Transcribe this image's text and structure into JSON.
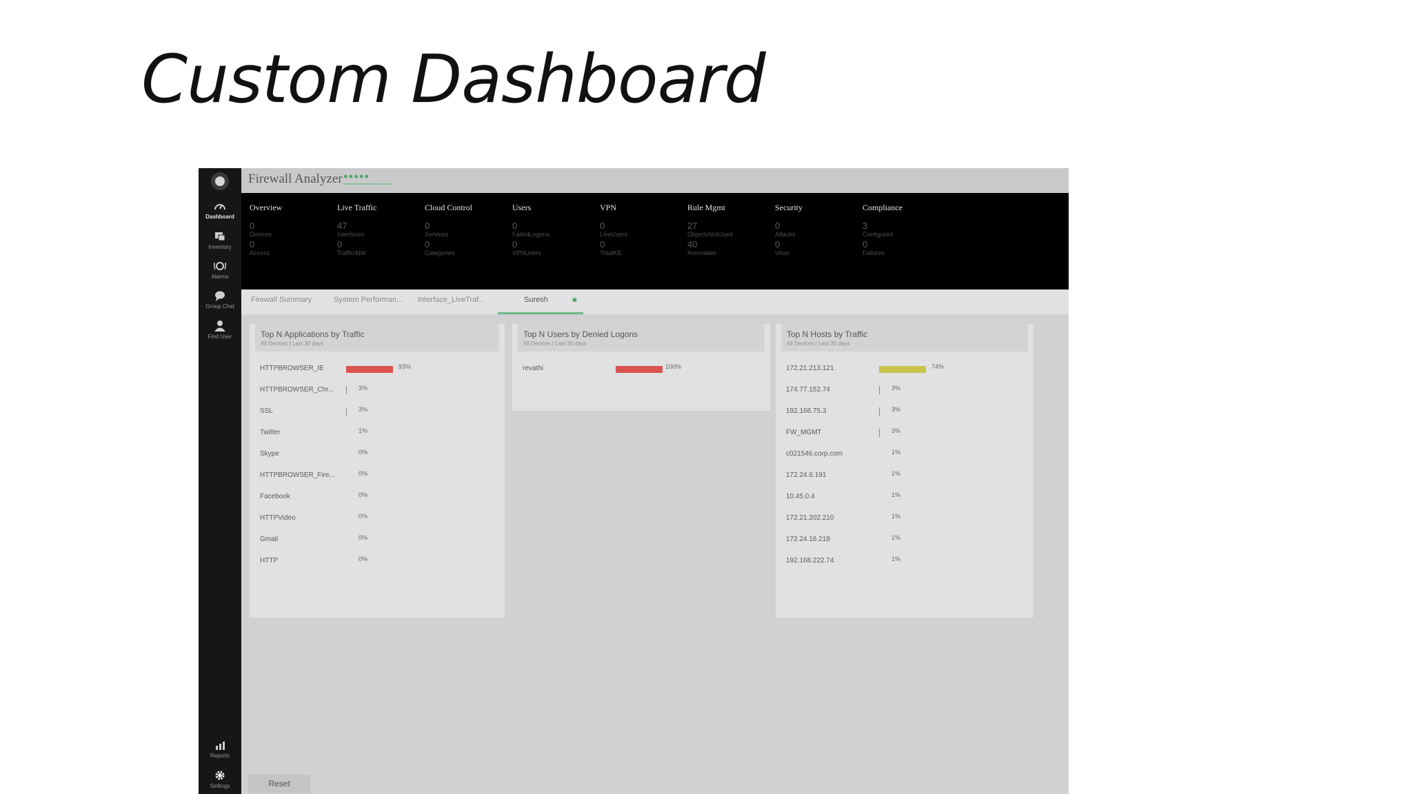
{
  "slide": {
    "title": "Custom Dashboard"
  },
  "app": {
    "title": "Firewall Analyzer",
    "stars": "●●●●●"
  },
  "sidebar": {
    "items": [
      {
        "label": "Dashboard",
        "icon": "gauge-icon"
      },
      {
        "label": "Inventory",
        "icon": "inventory-icon"
      },
      {
        "label": "Alarms",
        "icon": "alarm-icon"
      },
      {
        "label": "Group Chat",
        "icon": "chat-icon"
      },
      {
        "label": "Find User",
        "icon": "user-icon"
      }
    ],
    "bottom": [
      {
        "label": "Reports",
        "icon": "reports-icon"
      },
      {
        "label": "Settings",
        "icon": "gear-icon"
      }
    ]
  },
  "metrics": [
    {
      "title": "Overview",
      "rows": [
        {
          "value": "0",
          "label": "Devices"
        },
        {
          "value": "0",
          "label": "Access"
        }
      ]
    },
    {
      "title": "Live Traffic",
      "rows": [
        {
          "value": "47",
          "label": "Interfaces"
        },
        {
          "value": "0",
          "label": "Traffic/kbit"
        }
      ]
    },
    {
      "title": "Cloud Control",
      "rows": [
        {
          "value": "0",
          "label": "Services"
        },
        {
          "value": "0",
          "label": "Categories"
        }
      ]
    },
    {
      "title": "Users",
      "rows": [
        {
          "value": "0",
          "label": "FailedLogons"
        },
        {
          "value": "0",
          "label": "VPNUsers"
        }
      ]
    },
    {
      "title": "VPN",
      "rows": [
        {
          "value": "0",
          "label": "LiveUsers"
        },
        {
          "value": "0",
          "label": "TotalKB"
        }
      ]
    },
    {
      "title": "Rule Mgmt",
      "rows": [
        {
          "value": "27",
          "label": "ObjectsNotUsed"
        },
        {
          "value": "40",
          "label": "Anomalies"
        }
      ]
    },
    {
      "title": "Security",
      "rows": [
        {
          "value": "0",
          "label": "Attacks"
        },
        {
          "value": "0",
          "label": "Virus"
        }
      ]
    },
    {
      "title": "Compliance",
      "rows": [
        {
          "value": "3",
          "label": "Configured"
        },
        {
          "value": "0",
          "label": "Failures"
        }
      ]
    }
  ],
  "tabs": [
    {
      "label": "Firewall Summary"
    },
    {
      "label": "System Performan..."
    },
    {
      "label": "Interface_LiveTraf..."
    },
    {
      "label": "Suresh"
    }
  ],
  "panels": [
    {
      "title": "Top N Applications by Traffic",
      "subtitle": "All Devices | Last 30 days",
      "rows": [
        {
          "name": "HTTPBROWSER_IE",
          "pct": "93%",
          "value": 93,
          "color": "#d9534f"
        },
        {
          "name": "HTTPBROWSER_Chr...",
          "pct": "3%",
          "value": 3,
          "color": "#888888"
        },
        {
          "name": "SSL",
          "pct": "3%",
          "value": 3,
          "color": "#888888"
        },
        {
          "name": "Twitter",
          "pct": "1%",
          "value": 1,
          "color": "#888888"
        },
        {
          "name": "Skype",
          "pct": "0%",
          "value": 0,
          "color": "#888888"
        },
        {
          "name": "HTTPBROWSER_Fire...",
          "pct": "0%",
          "value": 0,
          "color": "#888888"
        },
        {
          "name": "Facebook",
          "pct": "0%",
          "value": 0,
          "color": "#888888"
        },
        {
          "name": "HTTPVideo",
          "pct": "0%",
          "value": 0,
          "color": "#888888"
        },
        {
          "name": "Gmail",
          "pct": "0%",
          "value": 0,
          "color": "#888888"
        },
        {
          "name": "HTTP",
          "pct": "0%",
          "value": 0,
          "color": "#888888"
        }
      ]
    },
    {
      "title": "Top N Users by Denied Logons",
      "subtitle": "All Devices | Last 30 days",
      "rows": [
        {
          "name": "revathi",
          "pct": "100%",
          "value": 100,
          "color": "#d9534f"
        }
      ]
    },
    {
      "title": "Top N Hosts by Traffic",
      "subtitle": "All Devices | Last 30 days",
      "rows": [
        {
          "name": "172.21.213.121",
          "pct": "74%",
          "value": 74,
          "color": "#c8c24a"
        },
        {
          "name": "174.77.152.74",
          "pct": "3%",
          "value": 3,
          "color": "#888888"
        },
        {
          "name": "192.168.75.3",
          "pct": "3%",
          "value": 3,
          "color": "#888888"
        },
        {
          "name": "FW_MGMT",
          "pct": "3%",
          "value": 3,
          "color": "#888888"
        },
        {
          "name": "c021546.corp.com",
          "pct": "1%",
          "value": 1,
          "color": "#888888"
        },
        {
          "name": "172.24.6.191",
          "pct": "1%",
          "value": 1,
          "color": "#888888"
        },
        {
          "name": "10.45.0.4",
          "pct": "1%",
          "value": 1,
          "color": "#888888"
        },
        {
          "name": "172.21.202.210",
          "pct": "1%",
          "value": 1,
          "color": "#888888"
        },
        {
          "name": "172.24.16.218",
          "pct": "1%",
          "value": 1,
          "color": "#888888"
        },
        {
          "name": "192.168.222.74",
          "pct": "1%",
          "value": 1,
          "color": "#888888"
        }
      ]
    }
  ],
  "reset_label": "Reset"
}
